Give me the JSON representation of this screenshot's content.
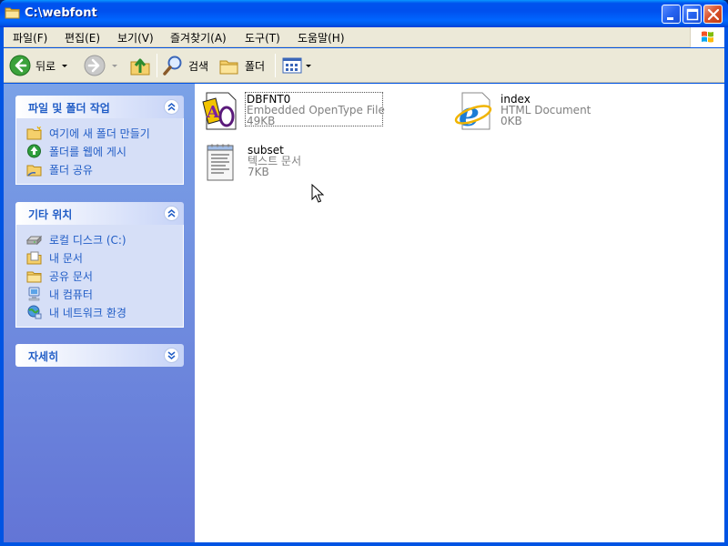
{
  "window": {
    "title": "C:\\webfont"
  },
  "menu": {
    "items": [
      {
        "label": "파일(F)"
      },
      {
        "label": "편집(E)"
      },
      {
        "label": "보기(V)"
      },
      {
        "label": "즐겨찾기(A)"
      },
      {
        "label": "도구(T)"
      },
      {
        "label": "도움말(H)"
      }
    ]
  },
  "toolbar": {
    "back_label": "뒤로",
    "search_label": "검색",
    "folders_label": "폴더"
  },
  "taskpane": {
    "file_tasks": {
      "title": "파일 및 폴더 작업",
      "items": [
        {
          "label": "여기에 새 폴더 만들기",
          "icon": "new-folder-icon"
        },
        {
          "label": "폴더를 웹에 게시",
          "icon": "publish-web-icon"
        },
        {
          "label": "폴더 공유",
          "icon": "share-folder-icon"
        }
      ]
    },
    "other_places": {
      "title": "기타 위치",
      "items": [
        {
          "label": "로컬 디스크 (C:)",
          "icon": "local-disk-icon"
        },
        {
          "label": "내 문서",
          "icon": "my-documents-icon"
        },
        {
          "label": "공유 문서",
          "icon": "shared-documents-icon"
        },
        {
          "label": "내 컴퓨터",
          "icon": "my-computer-icon"
        },
        {
          "label": "내 네트워크 환경",
          "icon": "my-network-icon"
        }
      ]
    },
    "details": {
      "title": "자세히"
    }
  },
  "files": [
    {
      "name": "DBFNT0",
      "type": "Embedded OpenType File",
      "size": "49KB",
      "icon": "eot-font-icon",
      "focused": true
    },
    {
      "name": "index",
      "type": "HTML Document",
      "size": "0KB",
      "icon": "ie-html-icon"
    },
    {
      "name": "subset",
      "type": "텍스트 문서",
      "size": "7KB",
      "icon": "notepad-text-icon"
    }
  ],
  "colors": {
    "title_bar": "#0058E8",
    "chrome": "#ECE9D8",
    "task_link": "#215DC6",
    "pane_top": "#7BA2E7",
    "pane_bottom": "#6375D6"
  }
}
